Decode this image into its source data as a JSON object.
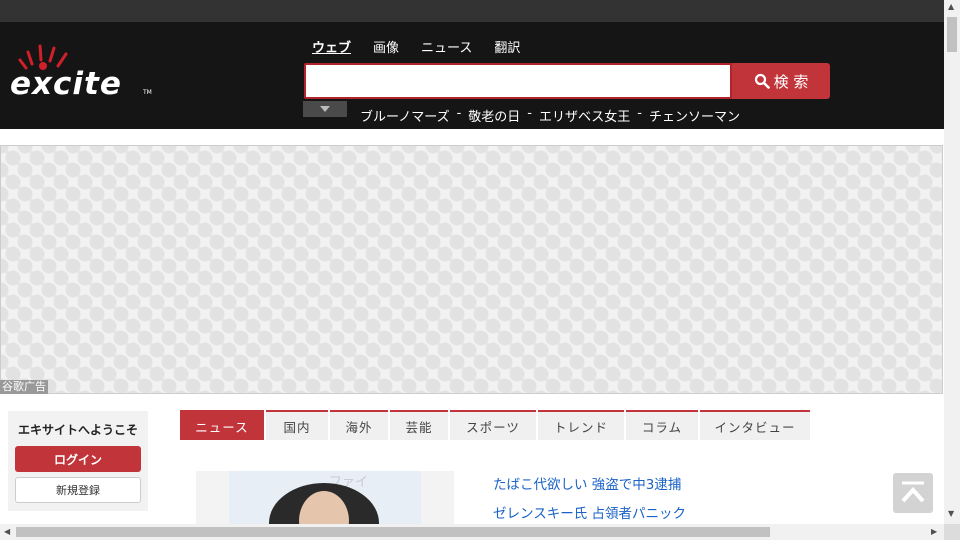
{
  "header": {
    "logo_text": "excite",
    "logo_tm": "TM",
    "nav_tabs": [
      {
        "label": "ウェブ",
        "active": true
      },
      {
        "label": "画像",
        "active": false
      },
      {
        "label": "ニュース",
        "active": false
      },
      {
        "label": "翻訳",
        "active": false
      }
    ],
    "search": {
      "value": "",
      "placeholder": "",
      "button_label": "検 索",
      "button_icon": "search-icon"
    },
    "trending": [
      "ブルーノマーズ",
      "敬老の日",
      "エリザベス女王",
      "チェンソーマン"
    ],
    "trending_separator": "-"
  },
  "ad": {
    "label": "谷歌广告"
  },
  "welcome": {
    "title": "エキサイトへようこそ",
    "login_label": "ログイン",
    "register_label": "新規登録"
  },
  "news": {
    "tabs": [
      {
        "label": "ニュース",
        "active": true
      },
      {
        "label": "国内",
        "active": false
      },
      {
        "label": "海外",
        "active": false
      },
      {
        "label": "芸能",
        "active": false
      },
      {
        "label": "スポーツ",
        "active": false
      },
      {
        "label": "トレンド",
        "active": false
      },
      {
        "label": "コラム",
        "active": false
      },
      {
        "label": "インタビュー",
        "active": false
      }
    ],
    "thumbnail_banner": "ファイ",
    "headlines": [
      "たばこ代欲しい 強盗で中3逮捕",
      "ゼレンスキー氏 占領者パニック"
    ]
  },
  "colors": {
    "accent": "#c0343a",
    "header_bg": "#151515",
    "link": "#1a62c7"
  }
}
